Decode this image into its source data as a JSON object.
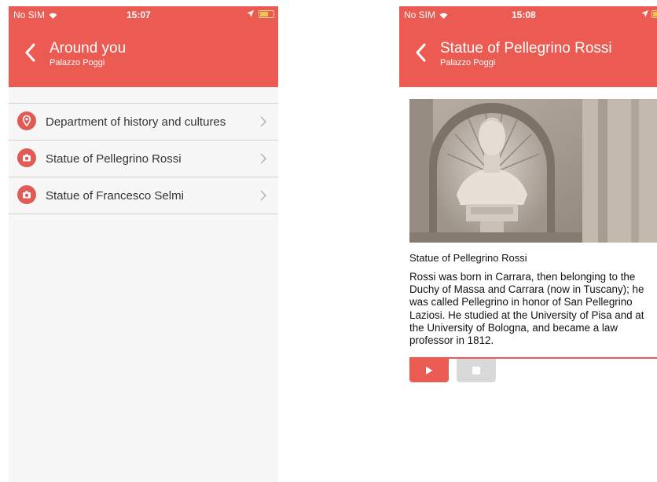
{
  "colors": {
    "header": "#ec5b52",
    "badge": "#e05b55",
    "stop_button": "#d9d9d9"
  },
  "left_screen": {
    "status_bar": {
      "carrier": "No SIM",
      "time": "15:07"
    },
    "header": {
      "title": "Around you",
      "subtitle": "Palazzo Poggi",
      "back_icon": "chevron-left-icon"
    },
    "items": [
      {
        "label": "Department of history and cultures",
        "icon": "location-pin-icon"
      },
      {
        "label": "Statue of Pellegrino Rossi",
        "icon": "camera-icon"
      },
      {
        "label": "Statue of Francesco Selmi",
        "icon": "camera-icon"
      }
    ]
  },
  "right_screen": {
    "status_bar": {
      "carrier": "No SIM",
      "time": "15:08"
    },
    "header": {
      "title": "Statue of Pellegrino Rossi",
      "subtitle": "Palazzo Poggi",
      "back_icon": "chevron-left-icon"
    },
    "caption": "Statue of Pellegrino Rossi",
    "description": "Rossi was born in Carrara, then belonging to the Duchy of Massa and Carrara (now in Tuscany); he was called Pellegrino in honor of San Pellegrino Laziosi. He studied at the University of Pisa and at the University of Bologna, and became a law professor in 1812.",
    "audio": {
      "play_icon": "play-icon",
      "stop_icon": "stop-icon"
    }
  }
}
